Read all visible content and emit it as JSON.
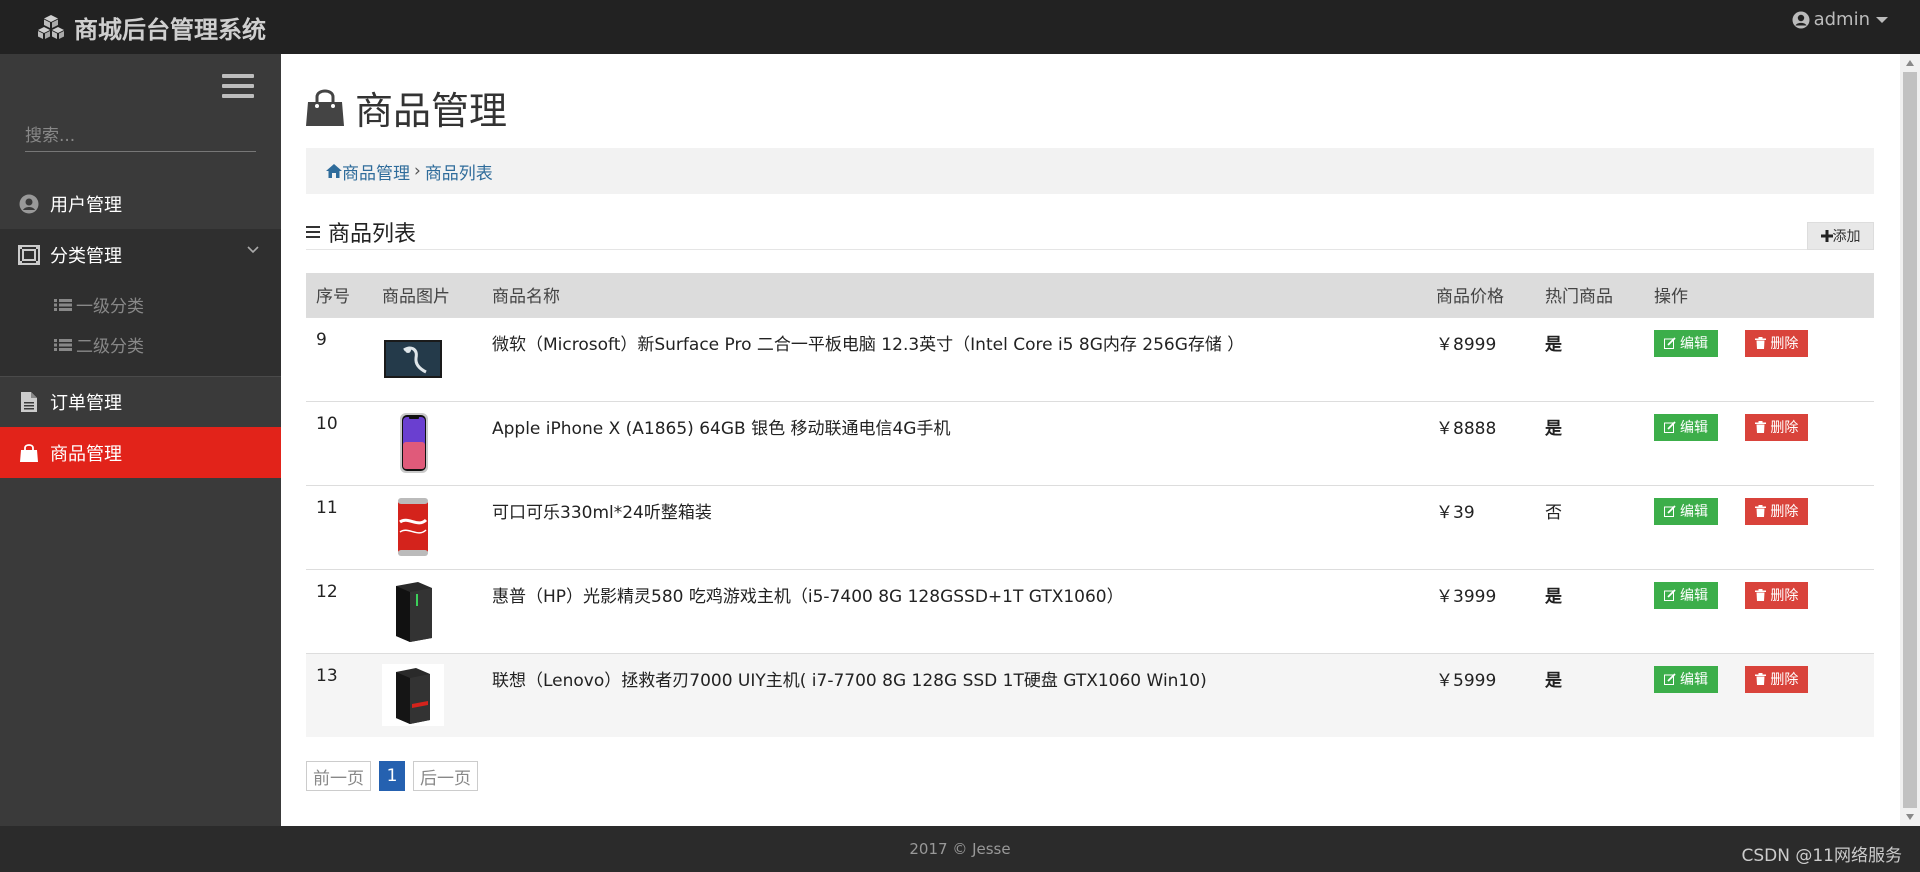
{
  "app": {
    "title": "商城后台管理系统",
    "user": "admin"
  },
  "sidebar": {
    "search_placeholder": "搜索...",
    "items": [
      {
        "label": "用户管理",
        "icon": "user-circle-icon"
      },
      {
        "label": "分类管理",
        "icon": "category-icon",
        "expanded": true
      },
      {
        "label": "订单管理",
        "icon": "file-icon"
      },
      {
        "label": "商品管理",
        "icon": "shopping-bag-icon",
        "active": true
      }
    ],
    "subitems": [
      {
        "label": "一级分类",
        "icon": "list-icon"
      },
      {
        "label": "二级分类",
        "icon": "list-icon"
      }
    ]
  },
  "main": {
    "title": "商品管理",
    "breadcrumb": [
      "商品管理",
      "商品列表"
    ],
    "section_title": "商品列表",
    "add_label": "添加",
    "table": {
      "headers": [
        "序号",
        "商品图片",
        "商品名称",
        "商品价格",
        "热门商品",
        "操作"
      ],
      "rows": [
        {
          "id": "9",
          "name": "微软（Microsoft）新Surface Pro 二合一平板电脑 12.3英寸（Intel Core i5 8G内存 256G存储 ）",
          "price": "￥8999",
          "hot": "是",
          "image": "tablet"
        },
        {
          "id": "10",
          "name": "Apple iPhone X (A1865) 64GB 银色 移动联通电信4G手机",
          "price": "￥8888",
          "hot": "是",
          "image": "phone"
        },
        {
          "id": "11",
          "name": "可口可乐330ml*24听整箱装",
          "price": "￥39",
          "hot": "否",
          "image": "can"
        },
        {
          "id": "12",
          "name": "惠普（HP）光影精灵580 吃鸡游戏主机（i5-7400 8G 128GSSD+1T GTX1060）",
          "price": "￥3999",
          "hot": "是",
          "image": "pc-tower"
        },
        {
          "id": "13",
          "name": "联想（Lenovo）拯救者刃7000 UIY主机( i7-7700 8G 128G SSD 1T硬盘 GTX1060 Win10)",
          "price": "￥5999",
          "hot": "是",
          "image": "pc-tower-red"
        }
      ],
      "edit_label": "编辑",
      "delete_label": "删除"
    },
    "pager": {
      "prev": "前一页",
      "current": "1",
      "next": "后一页"
    }
  },
  "footer": {
    "text": "2017 © Jesse"
  },
  "watermark": "CSDN @11网络服务",
  "colors": {
    "accent": "#e2231a",
    "edit": "#3cae4a",
    "delete": "#d9433b",
    "link": "#2f6c9b",
    "pager_active": "#2561b0"
  }
}
